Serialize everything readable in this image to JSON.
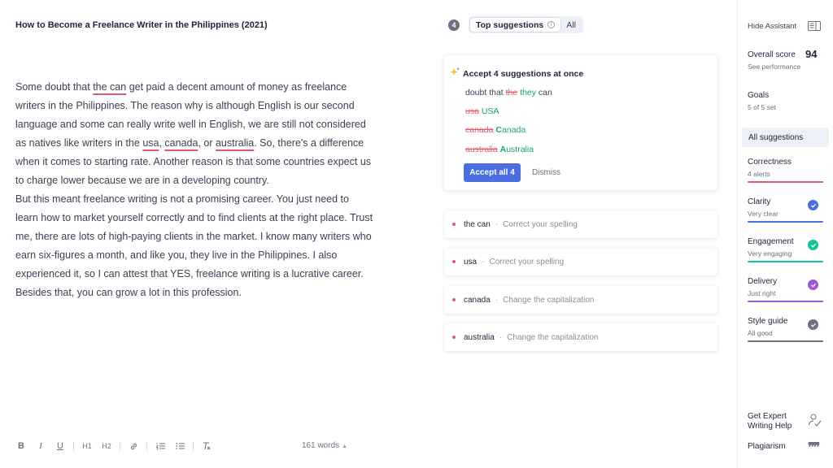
{
  "editor": {
    "title": "How to Become a Freelance Writer in the Philippines (2021)",
    "paragraph1": {
      "p1": "Some doubt that ",
      "flag1": "the can",
      "p2": " get paid a decent amount of money as freelance writers in the Philippines. The reason why is although English is our second language and some can really write well in English, we are still not considered as natives like writers in the ",
      "flag2": "usa",
      "p3": ", ",
      "flag3": "canada",
      "p4": ", or ",
      "flag4": "australia",
      "p5": ". So, there's a difference when it comes to starting rate. Another reason is that some countries expect us to charge lower because we are in a developing country."
    },
    "paragraph2": "But this meant freelance writing is not a promising career. You just need to learn how to market yourself correctly and to find clients at the right place. Trust me, there are lots of high-paying clients in the market. I know many writers who earn six-figures a month, and like you, they live in the Philippines. I also experienced it, so I can attest that YES, freelance writing is a lucrative career. Besides that, you can grow a lot in this profession.",
    "word_count": "161 words",
    "toolbar": {
      "bold": "B",
      "italic": "I",
      "underline": "U",
      "h1": "H1",
      "h2": "H2"
    }
  },
  "suggestions_panel": {
    "count": "4",
    "tabs": [
      {
        "label": "Top suggestions",
        "active": true
      },
      {
        "label": "All",
        "active": false
      }
    ],
    "bulk": {
      "title": "Accept 4 suggestions at once",
      "preview1": {
        "before": "doubt that ",
        "deleted": "the",
        "inserted": "they",
        "after": " can"
      },
      "preview2": {
        "deleted": "usa",
        "inserted": "USA"
      },
      "preview3": {
        "deleted": "canada",
        "inserted_bold": "C",
        "inserted_rest": "anada"
      },
      "preview4": {
        "deleted": "australia",
        "inserted_bold": "A",
        "inserted_rest": "ustralia"
      },
      "accept_label": "Accept all 4",
      "dismiss_label": "Dismiss"
    },
    "cards": [
      {
        "word": "the can",
        "description": "Correct your spelling"
      },
      {
        "word": "usa",
        "description": "Correct your spelling"
      },
      {
        "word": "canada",
        "description": "Change the capitalization"
      },
      {
        "word": "australia",
        "description": "Change the capitalization"
      }
    ],
    "separator": "·"
  },
  "sidebar": {
    "hide_assistant": "Hide Assistant",
    "overall_score_label": "Overall score",
    "overall_score": "94",
    "see_performance": "See performance",
    "goals_label": "Goals",
    "goals_value": "5 of 5 set",
    "all_suggestions": "All suggestions",
    "categories": [
      {
        "name": "Correctness",
        "status": "4 alerts",
        "color": "#e05a6d"
      },
      {
        "name": "Clarity",
        "status": "Very clear",
        "color": "#4a6ee0"
      },
      {
        "name": "Engagement",
        "status": "Very engaging",
        "color": "#15c39a"
      },
      {
        "name": "Delivery",
        "status": "Just right",
        "color": "#9b59d6"
      },
      {
        "name": "Style guide",
        "status": "All good",
        "color": "#6d7182"
      }
    ],
    "expert_help": "Get Expert Writing Help",
    "plagiarism": "Plagiarism"
  },
  "colors": {
    "accent": "#4a6ee0",
    "error": "#e05a6d",
    "inserted": "#15a37c"
  }
}
